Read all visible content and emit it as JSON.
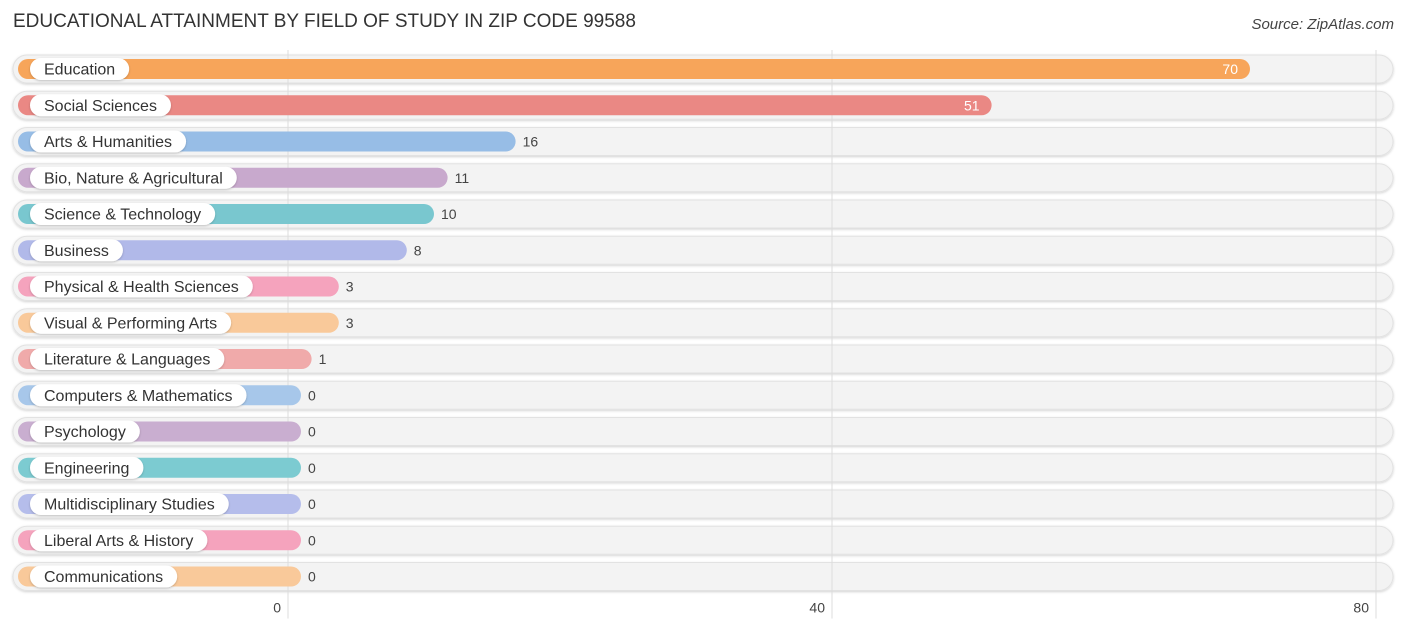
{
  "header": {
    "title": "EDUCATIONAL ATTAINMENT BY FIELD OF STUDY IN ZIP CODE 99588",
    "source": "Source: ZipAtlas.com"
  },
  "chart_data": {
    "type": "bar",
    "orientation": "horizontal",
    "title": "EDUCATIONAL ATTAINMENT BY FIELD OF STUDY IN ZIP CODE 99588",
    "xlabel": "",
    "ylabel": "",
    "xlim": [
      0,
      80
    ],
    "xticks": [
      0,
      40,
      80
    ],
    "xtick_labels": [
      "0",
      "40",
      "80"
    ],
    "grid": true,
    "categories": [
      "Education",
      "Social Sciences",
      "Arts & Humanities",
      "Bio, Nature & Agricultural",
      "Science & Technology",
      "Business",
      "Physical & Health Sciences",
      "Visual & Performing Arts",
      "Literature & Languages",
      "Computers & Mathematics",
      "Psychology",
      "Engineering",
      "Multidisciplinary Studies",
      "Liberal Arts & History",
      "Communications"
    ],
    "values": [
      70,
      51,
      16,
      11,
      10,
      8,
      3,
      3,
      1,
      0,
      0,
      0,
      0,
      0,
      0
    ],
    "colors": [
      "#f7a55a",
      "#ea8884",
      "#97bde6",
      "#c8a9cd",
      "#79c7cf",
      "#b1b9e9",
      "#f5a3bd",
      "#f9c99a",
      "#f0aaaa",
      "#a7c7ea",
      "#c9aed0",
      "#7ccbd1",
      "#b5bdeb",
      "#f5a3bd",
      "#f9c99a"
    ]
  }
}
